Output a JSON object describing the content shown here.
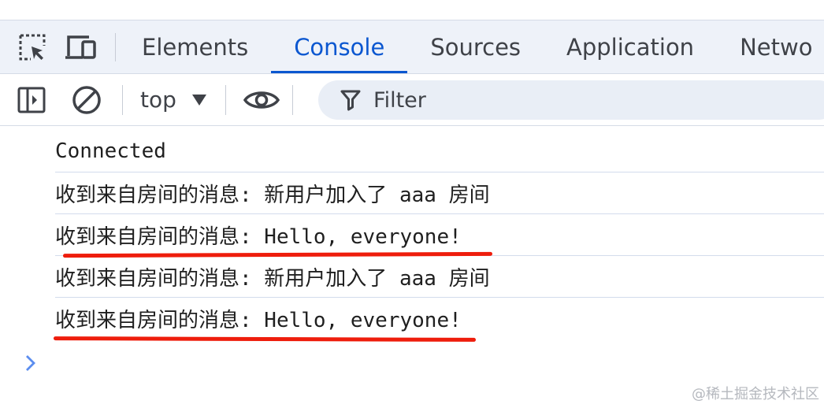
{
  "tabs": [
    "Elements",
    "Console",
    "Sources",
    "Application",
    "Netwo"
  ],
  "active_tab": "Console",
  "toolbar": {
    "context": "top",
    "filter_placeholder": "Filter"
  },
  "messages": [
    "Connected",
    "收到来自房间的消息: 新用户加入了 aaa 房间",
    "收到来自房间的消息: Hello, everyone!",
    "收到来自房间的消息: 新用户加入了 aaa 房间",
    "收到来自房间的消息: Hello, everyone!"
  ],
  "watermark": "@稀土掘金技术社区",
  "colors": {
    "accent": "#0b57d0",
    "annotation": "#ee1d0c",
    "tab_bar_bg": "#eef2f9",
    "filter_bg": "#e9eef6"
  },
  "icons": {
    "inspect": "inspect-element-icon",
    "device": "device-toolbar-icon",
    "sidebar": "sidebar-toggle-icon",
    "clear": "clear-console-icon",
    "eye": "live-expression-eye-icon",
    "filter": "filter-funnel-icon",
    "prompt": "console-prompt-chevron-icon"
  }
}
